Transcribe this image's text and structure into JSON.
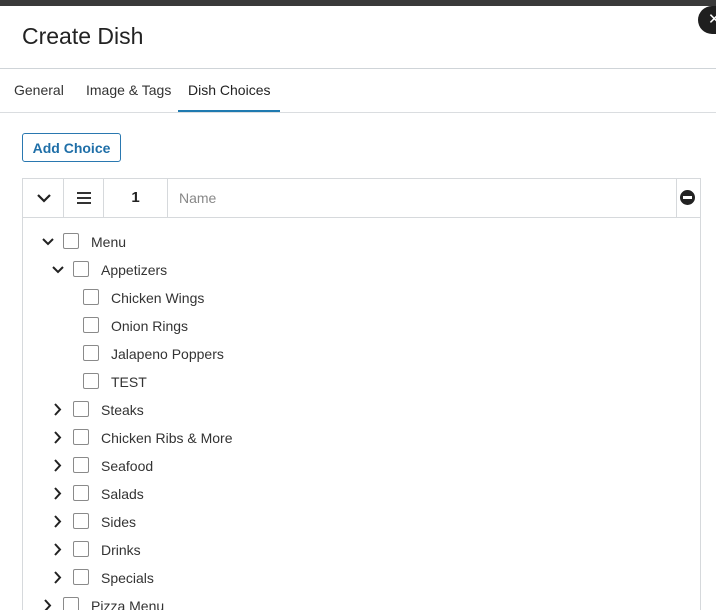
{
  "dialog": {
    "title": "Create Dish",
    "close_icon": "close-icon"
  },
  "tabs": [
    {
      "label": "General",
      "active": false
    },
    {
      "label": "Image & Tags",
      "active": false
    },
    {
      "label": "Dish Choices",
      "active": true
    }
  ],
  "add_choice_label": "Add Choice",
  "choice": {
    "number": "1",
    "name_value": "",
    "name_placeholder": "Name"
  },
  "tree": [
    {
      "label": "Menu",
      "expanded": true,
      "level": 0
    },
    {
      "label": "Appetizers",
      "expanded": true,
      "level": 1
    },
    {
      "label": "Chicken Wings",
      "level": 2
    },
    {
      "label": "Onion Rings",
      "level": 2
    },
    {
      "label": "Jalapeno Poppers",
      "level": 2
    },
    {
      "label": "TEST",
      "level": 2
    },
    {
      "label": "Steaks",
      "expanded": false,
      "level": 1
    },
    {
      "label": "Chicken Ribs & More",
      "expanded": false,
      "level": 1
    },
    {
      "label": "Seafood",
      "expanded": false,
      "level": 1
    },
    {
      "label": "Salads",
      "expanded": false,
      "level": 1
    },
    {
      "label": "Sides",
      "expanded": false,
      "level": 1
    },
    {
      "label": "Drinks",
      "expanded": false,
      "level": 1
    },
    {
      "label": "Specials",
      "expanded": false,
      "level": 1
    },
    {
      "label": "Pizza Menu",
      "expanded": false,
      "level": 0
    }
  ],
  "colors": {
    "accent": "#1f7ab0",
    "overlay": "#3a3a3a"
  }
}
